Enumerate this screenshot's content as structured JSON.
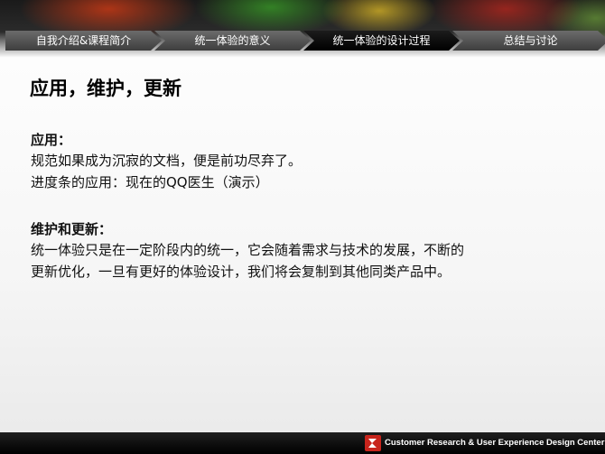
{
  "nav": {
    "tabs": [
      {
        "label": "自我介绍&课程简介",
        "active": false
      },
      {
        "label": "统一体验的意义",
        "active": false
      },
      {
        "label": "统一体验的设计过程",
        "active": true
      },
      {
        "label": "总结与讨论",
        "active": false
      }
    ]
  },
  "slide": {
    "title": "应用，维护，更新",
    "sections": [
      {
        "heading": "应用：",
        "lines": [
          "规范如果成为沉寂的文档，便是前功尽弃了。",
          "进度条的应用：现在的QQ医生（演示）"
        ]
      },
      {
        "heading": "维护和更新：",
        "lines": [
          "统一体验只是在一定阶段内的统一，它会随着需求与技术的发展，不断的",
          "更新优化，一旦有更好的体验设计，我们将会复制到其他同类产品中。"
        ]
      }
    ]
  },
  "footer": {
    "text": "Customer Research & User Experience Design Center",
    "logo_icon": "cdc-logo-icon",
    "brand_color": "#c8241c"
  }
}
